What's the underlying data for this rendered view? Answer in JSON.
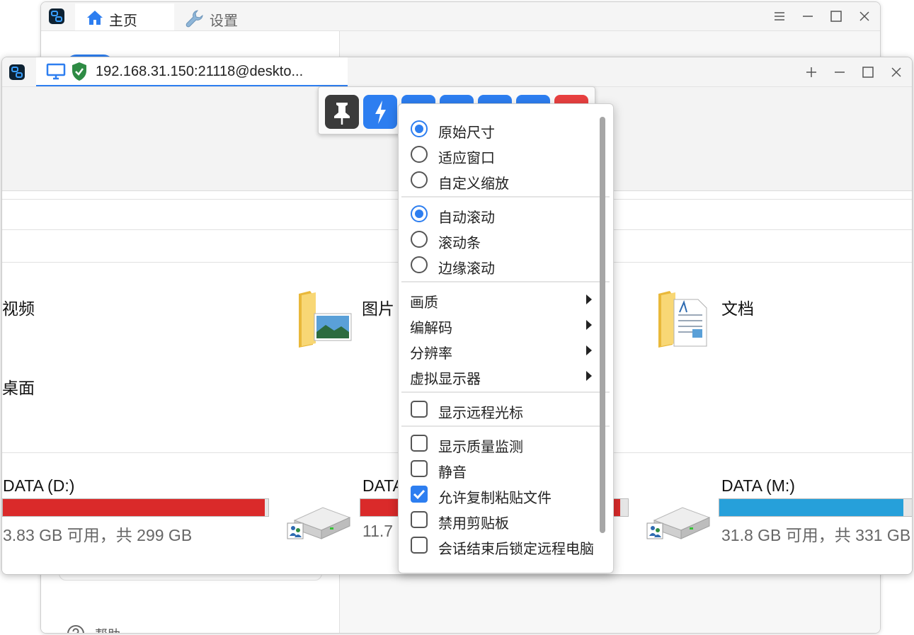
{
  "main_window": {
    "tabs": [
      {
        "label": "主页",
        "icon": "home-icon",
        "active": true
      },
      {
        "label": "设置",
        "icon": "wrench-icon",
        "active": false
      }
    ],
    "help_label": "帮助",
    "accent_color": "#2d7ef0"
  },
  "session_window": {
    "tab_title": "192.168.31.150:21118@deskto...",
    "secure": true
  },
  "remote_explorer": {
    "folders": [
      {
        "label": "视频"
      },
      {
        "label": "图片",
        "icon": "pictures-folder-icon"
      },
      {
        "label": "文档",
        "icon": "documents-folder-icon"
      },
      {
        "label": "桌面"
      }
    ],
    "drives": [
      {
        "name": "DATA (D:)",
        "sub": "3.83 GB 可用，共 299 GB",
        "used_fraction": 0.987,
        "color": "#da2a2a"
      },
      {
        "name": "DATA",
        "sub": "11.7",
        "used_fraction": 0.97,
        "color": "#da2a2a"
      },
      {
        "name": "DATA (M:)",
        "sub": "31.8 GB 可用，共 331 GB",
        "used_fraction": 0.904,
        "color": "#26a0da"
      }
    ]
  },
  "toolbar": {
    "buttons": [
      {
        "icon": "pin-icon"
      },
      {
        "icon": "lightning-icon"
      },
      {
        "icon": "display-icon"
      },
      {
        "icon": "chat-icon"
      },
      {
        "icon": "keyboard-icon"
      },
      {
        "icon": "tools-icon"
      },
      {
        "icon": "close-icon"
      }
    ]
  },
  "context_menu": {
    "scale_options": [
      {
        "label": "原始尺寸",
        "selected": true
      },
      {
        "label": "适应窗口",
        "selected": false
      },
      {
        "label": "自定义缩放",
        "selected": false
      }
    ],
    "scroll_options": [
      {
        "label": "自动滚动",
        "selected": true
      },
      {
        "label": "滚动条",
        "selected": false
      },
      {
        "label": "边缘滚动",
        "selected": false
      }
    ],
    "submenus": [
      {
        "label": "画质"
      },
      {
        "label": "编解码"
      },
      {
        "label": "分辨率"
      },
      {
        "label": "虚拟显示器"
      }
    ],
    "cursor_option": {
      "label": "显示远程光标",
      "checked": false
    },
    "options": [
      {
        "label": "显示质量监测",
        "checked": false
      },
      {
        "label": "静音",
        "checked": false
      },
      {
        "label": "允许复制粘贴文件",
        "checked": true
      },
      {
        "label": "禁用剪贴板",
        "checked": false
      },
      {
        "label": "会话结束后锁定远程电脑",
        "checked": false
      }
    ]
  }
}
